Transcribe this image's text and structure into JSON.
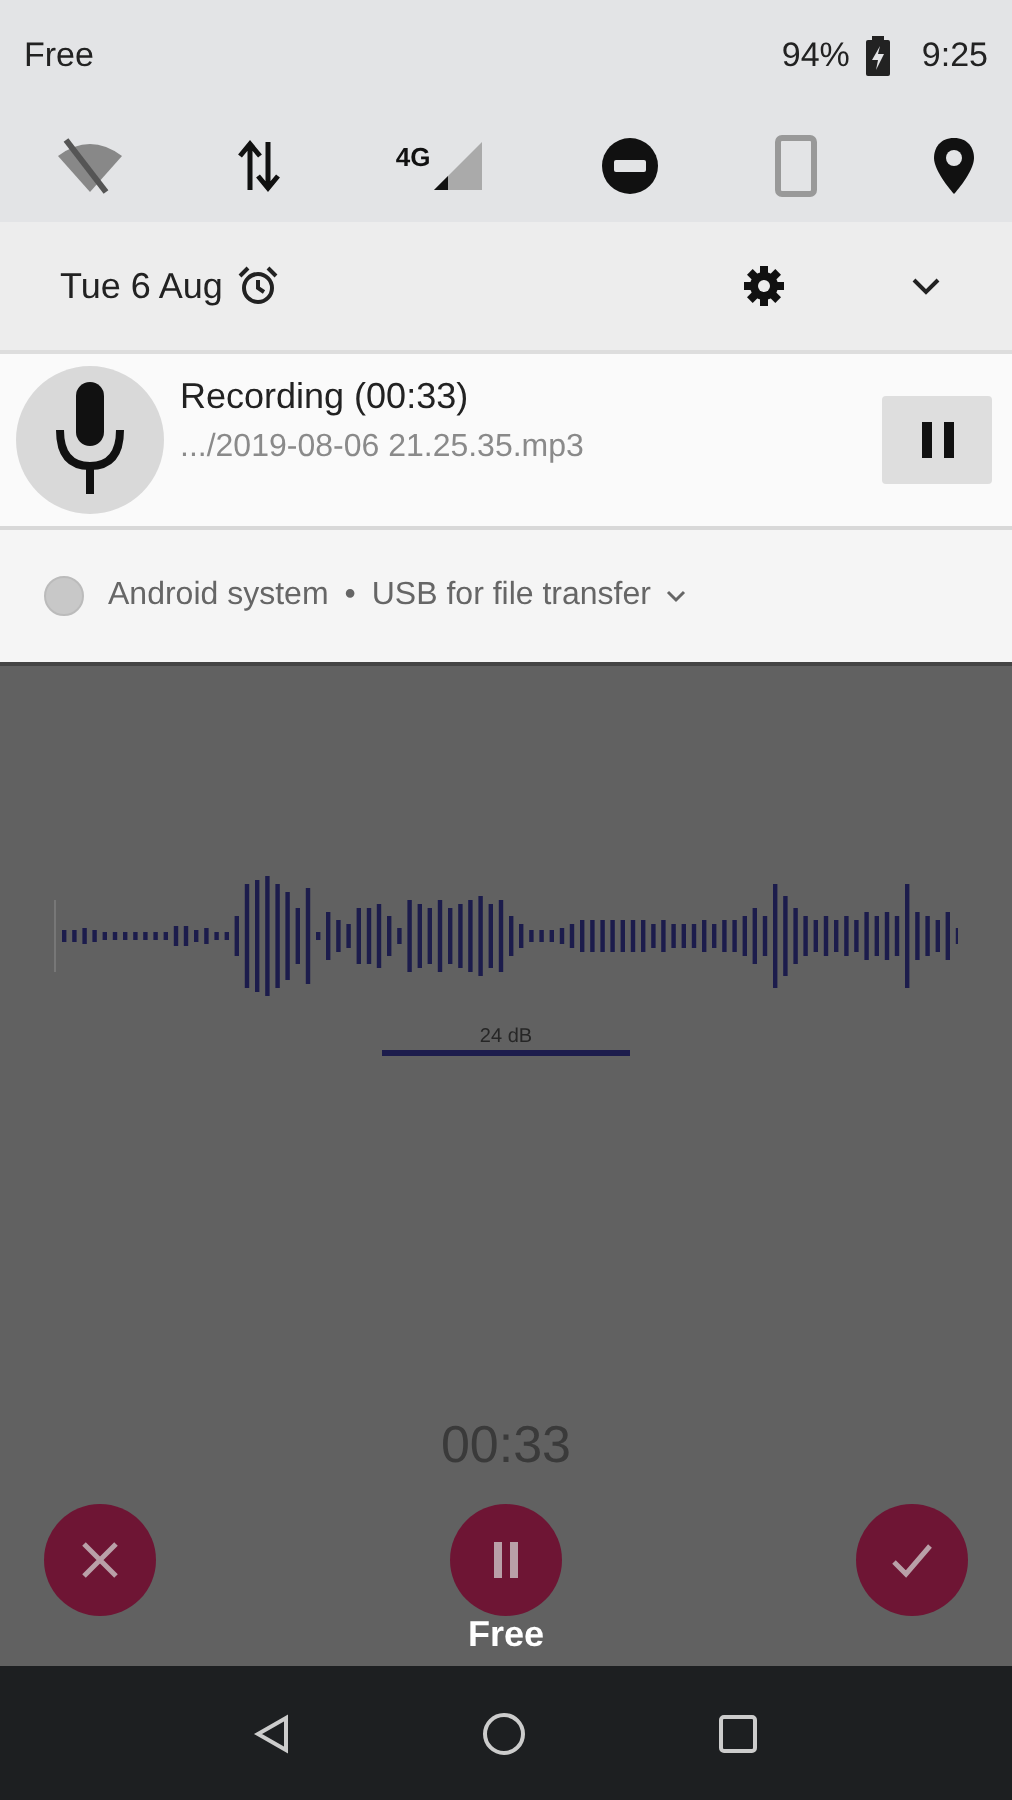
{
  "status_bar": {
    "carrier": "Free",
    "battery": "94%",
    "time": "9:25"
  },
  "quick_settings": {
    "network_label": "4G",
    "date": "Tue 6 Aug"
  },
  "notification": {
    "title": "Recording (00:33)",
    "file": ".../2019-08-06 21.25.35.mp3"
  },
  "system_notification": {
    "app": "Android system",
    "separator": "•",
    "text": "USB for file transfer"
  },
  "recorder": {
    "meter_label": "24 dB",
    "elapsed": "00:33",
    "buttons": [
      {
        "kind": "discard"
      },
      {
        "kind": "pause"
      },
      {
        "kind": "save"
      }
    ]
  },
  "toast": "Free"
}
